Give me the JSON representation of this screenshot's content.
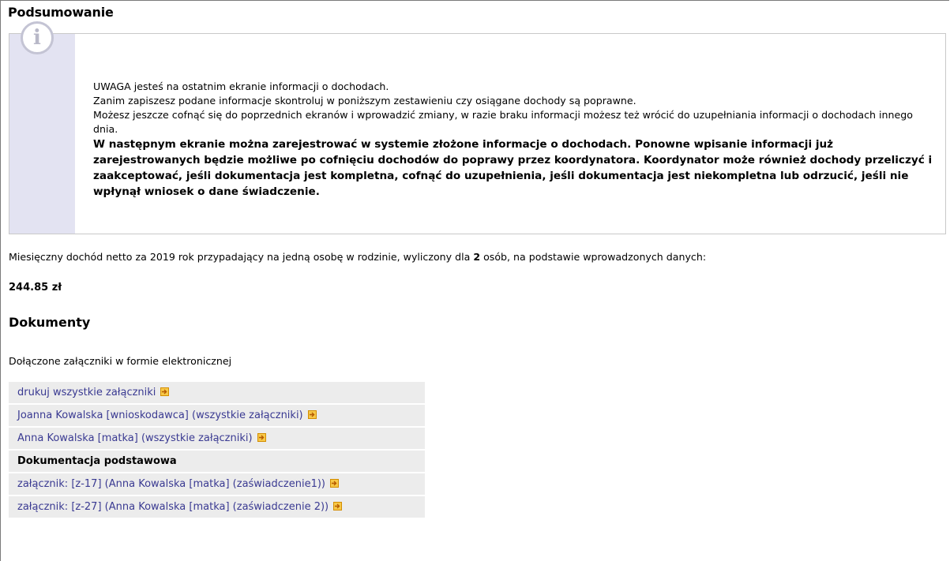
{
  "summary_heading": "Podsumowanie",
  "info": {
    "icon": "info-icon",
    "lines": [
      "UWAGA jesteś na ostatnim ekranie informacji o dochodach.",
      "Zanim zapiszesz podane informacje skontroluj w poniższym zestawieniu czy osiągane dochody są poprawne.",
      "Możesz jeszcze cofnąć się do poprzednich ekranów i wprowadzić zmiany, w razie braku informacji możesz też wrócić do uzupełniania informacji o dochodach innego dnia."
    ],
    "bold_text": "W następnym ekranie można zarejestrować w systemie złożone informacje o dochodach. Ponowne wpisanie informacji już zarejestrowanych będzie możliwe po cofnięciu dochodów do poprawy przez koordynatora. Koordynator może również dochody przeliczyć i zaakceptować, jeśli dokumentacja jest kompletna, cofnąć do uzupełnienia, jeśli dokumentacja jest niekompletna lub odrzucić, jeśli nie wpłynął wniosek o dane świadczenie."
  },
  "income": {
    "prefix": "Miesięczny dochód netto za 2019 rok przypadający na jedną osobę w rodzinie, wyliczony dla ",
    "persons": "2",
    "suffix": " osób, na podstawie wprowadzonych danych:",
    "amount": "244.85 zł"
  },
  "documents": {
    "heading": "Dokumenty",
    "note": "Dołączone załączniki w formie elektronicznej",
    "rows": [
      {
        "label": "drukuj wszystkie załączniki"
      },
      {
        "label": "Joanna Kowalska [wnioskodawca] (wszystkie załączniki)"
      },
      {
        "label": "Anna Kowalska [matka] (wszystkie załączniki)"
      },
      {
        "label": "Dokumentacja podstawowa"
      },
      {
        "label": "załącznik: [z-17] (Anna Kowalska [matka] (zaświadczenie1))"
      },
      {
        "label": "załącznik: [z-27] (Anna Kowalska [matka] (zaświadczenie 2))"
      }
    ],
    "link_icon": "arrow-right-icon"
  }
}
